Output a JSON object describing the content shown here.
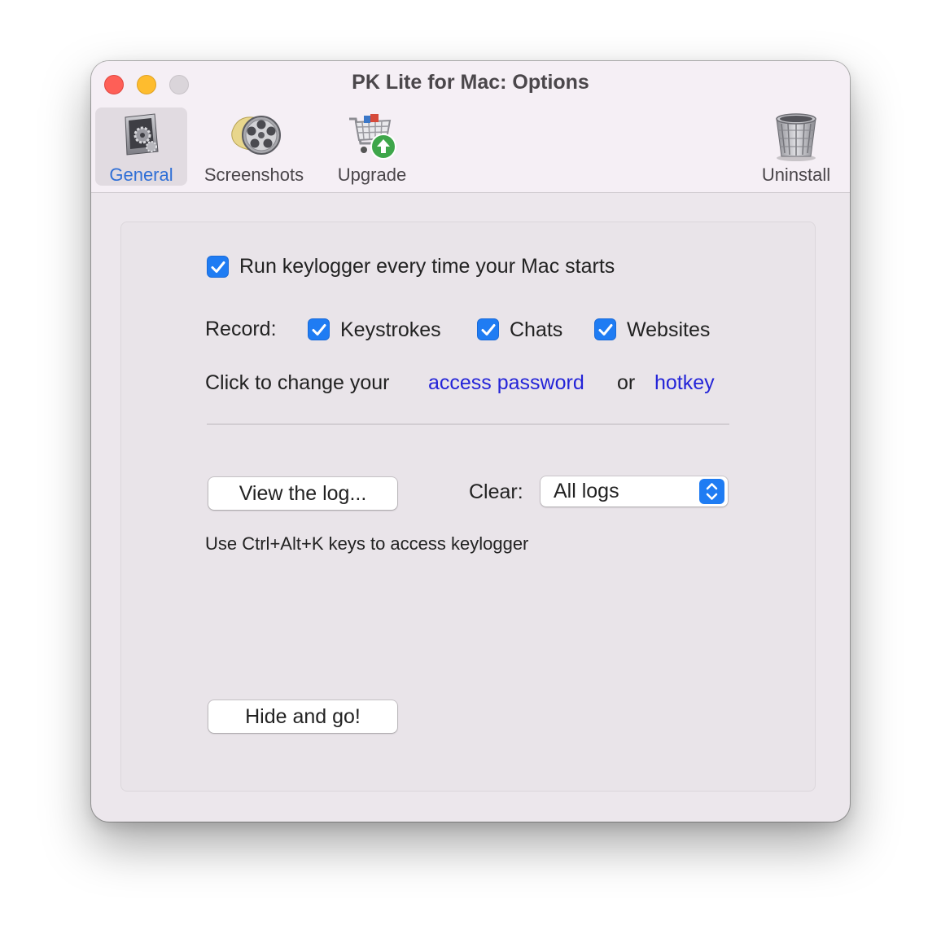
{
  "window": {
    "title": "PK Lite for Mac: Options"
  },
  "toolbar": {
    "items": [
      {
        "label": "General",
        "icon": "general-settings-icon",
        "selected": true
      },
      {
        "label": "Screenshots",
        "icon": "film-reel-icon",
        "selected": false
      },
      {
        "label": "Upgrade",
        "icon": "shopping-cart-upgrade-icon",
        "selected": false
      },
      {
        "label": "Uninstall",
        "icon": "trash-can-icon",
        "selected": false
      }
    ]
  },
  "general": {
    "run_at_startup": {
      "label": "Run keylogger every time your Mac starts",
      "checked": true
    },
    "record_label": "Record:",
    "record_options": [
      {
        "label": "Keystrokes",
        "checked": true
      },
      {
        "label": "Chats",
        "checked": true
      },
      {
        "label": "Websites",
        "checked": true
      }
    ],
    "change_prefix": "Click to change your",
    "access_password_link": "access password",
    "or_text": "or",
    "hotkey_link": "hotkey",
    "view_log_button": "View the log...",
    "clear_label": "Clear:",
    "clear_select_value": "All logs",
    "hotkey_hint": "Use Ctrl+Alt+K keys to access keylogger",
    "hide_button": "Hide and go!"
  },
  "colors": {
    "accent": "#1f7cf3",
    "link": "#2424d8",
    "selected_tab_text": "#2f6fd6"
  }
}
